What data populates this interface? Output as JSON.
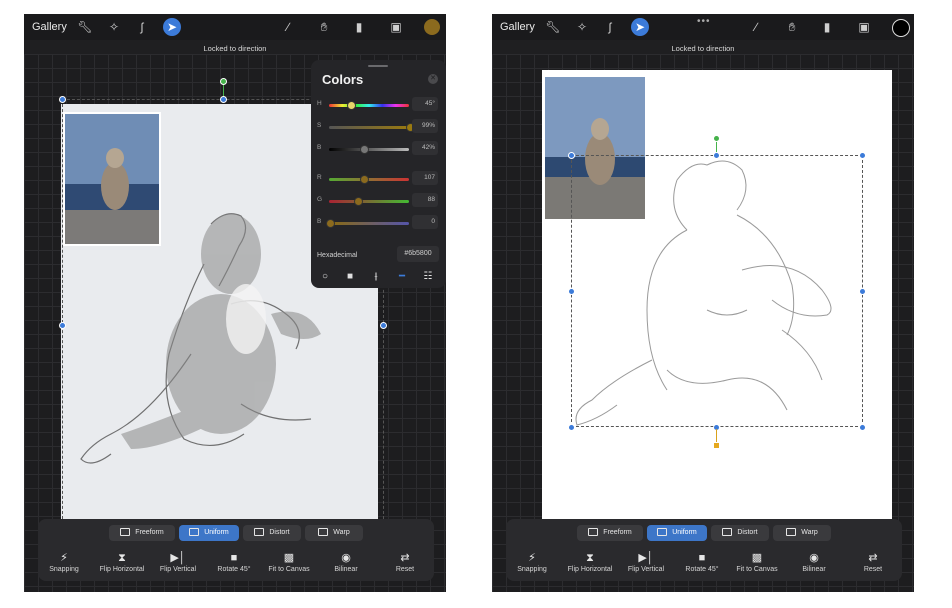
{
  "screens": {
    "left": {
      "toolbar": {
        "gallery": "Gallery",
        "actions_icon": "wrench-icon",
        "adjust_icon": "magic-wand-icon",
        "select_icon": "s-select-icon",
        "transform_icon": "arrow-cursor-icon",
        "brush_icon": "brush-icon",
        "smudge_icon": "smudge-icon",
        "eraser_icon": "eraser-icon",
        "layers_icon": "layers-icon",
        "color": "#8b6a1e"
      },
      "status": "Locked to direction",
      "colors_panel": {
        "title": "Colors",
        "sliders": [
          {
            "label": "H",
            "value": "45°",
            "level": 0.13
          },
          {
            "label": "S",
            "value": "99%",
            "level": 0.99
          },
          {
            "label": "B",
            "value": "42%",
            "level": 0.42
          },
          {
            "label": "R",
            "value": "107",
            "level": 0.42
          },
          {
            "label": "G",
            "value": "88",
            "level": 0.35
          },
          {
            "label": "B",
            "value": "0",
            "level": 0.0
          }
        ],
        "hex_label": "Hexadecimal",
        "hex_value": "#6b5800"
      },
      "modes": [
        "Freeform",
        "Uniform",
        "Distort",
        "Warp"
      ],
      "active_mode": "Uniform",
      "tools": [
        "Snapping",
        "Flip Horizontal",
        "Flip Vertical",
        "Rotate 45°",
        "Fit to Canvas",
        "Bilinear",
        "Reset"
      ]
    },
    "right": {
      "toolbar": {
        "gallery": "Gallery",
        "more": "•••",
        "color": "#000000"
      },
      "status": "Locked to direction",
      "modes": [
        "Freeform",
        "Uniform",
        "Distort",
        "Warp"
      ],
      "active_mode": "Uniform",
      "tools": [
        "Snapping",
        "Flip Horizontal",
        "Flip Vertical",
        "Rotate 45°",
        "Fit to Canvas",
        "Bilinear",
        "Reset"
      ]
    }
  }
}
